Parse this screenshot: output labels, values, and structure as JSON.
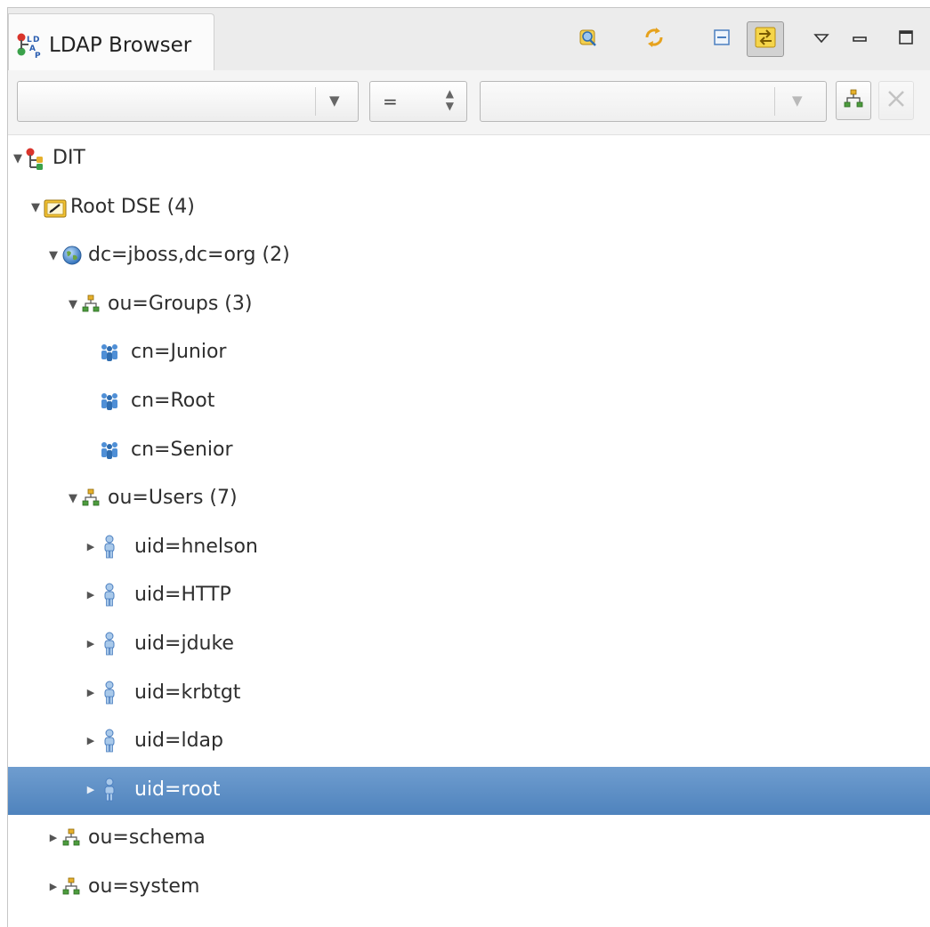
{
  "view": {
    "title": "LDAP Browser",
    "icon": "ldap-browser-icon"
  },
  "toolbar": {
    "buttons": [
      {
        "name": "open-quick-search-icon",
        "pressed": false
      },
      {
        "name": "refresh-icon",
        "pressed": false
      },
      {
        "name": "collapse-all-icon",
        "pressed": false
      },
      {
        "name": "link-with-editor-icon",
        "pressed": true
      },
      {
        "name": "view-menu-icon",
        "pressed": false
      },
      {
        "name": "minimize-icon",
        "pressed": false
      },
      {
        "name": "maximize-icon",
        "pressed": false
      }
    ]
  },
  "filter": {
    "attribute_value": "",
    "operator": "=",
    "search_value": "",
    "apply_button": "apply-filter-icon",
    "clear_button": "clear-filter-icon"
  },
  "tree": [
    {
      "label": "DIT",
      "level": 0,
      "expanded": true,
      "has_children": true,
      "icon": "dit-icon"
    },
    {
      "label": "Root DSE (4)",
      "level": 1,
      "expanded": true,
      "has_children": true,
      "icon": "root-dse-icon"
    },
    {
      "label": "dc=jboss,dc=org (2)",
      "level": 2,
      "expanded": true,
      "has_children": true,
      "icon": "globe-icon"
    },
    {
      "label": "ou=Groups (3)",
      "level": 3,
      "expanded": true,
      "has_children": true,
      "icon": "org-unit-icon"
    },
    {
      "label": "cn=Junior",
      "level": 4,
      "expanded": false,
      "has_children": false,
      "icon": "group-icon"
    },
    {
      "label": "cn=Root",
      "level": 4,
      "expanded": false,
      "has_children": false,
      "icon": "group-icon"
    },
    {
      "label": "cn=Senior",
      "level": 4,
      "expanded": false,
      "has_children": false,
      "icon": "group-icon"
    },
    {
      "label": "ou=Users (7)",
      "level": 3,
      "expanded": true,
      "has_children": true,
      "icon": "org-unit-icon"
    },
    {
      "label": "uid=hnelson",
      "level": 4,
      "expanded": false,
      "has_children": true,
      "icon": "user-icon"
    },
    {
      "label": "uid=HTTP",
      "level": 4,
      "expanded": false,
      "has_children": true,
      "icon": "user-icon"
    },
    {
      "label": "uid=jduke",
      "level": 4,
      "expanded": false,
      "has_children": true,
      "icon": "user-icon"
    },
    {
      "label": "uid=krbtgt",
      "level": 4,
      "expanded": false,
      "has_children": true,
      "icon": "user-icon"
    },
    {
      "label": "uid=ldap",
      "level": 4,
      "expanded": false,
      "has_children": true,
      "icon": "user-icon"
    },
    {
      "label": "uid=root",
      "level": 4,
      "expanded": false,
      "has_children": true,
      "icon": "user-icon",
      "selected": true
    },
    {
      "label": "ou=schema",
      "level": 2,
      "expanded": false,
      "has_children": true,
      "icon": "org-unit-icon"
    },
    {
      "label": "ou=system",
      "level": 2,
      "expanded": false,
      "has_children": true,
      "icon": "org-unit-icon"
    }
  ],
  "colors": {
    "selection": "#5b8fc7",
    "group_icon": "#4f8fd6",
    "folder_icon": "#f2c233"
  }
}
